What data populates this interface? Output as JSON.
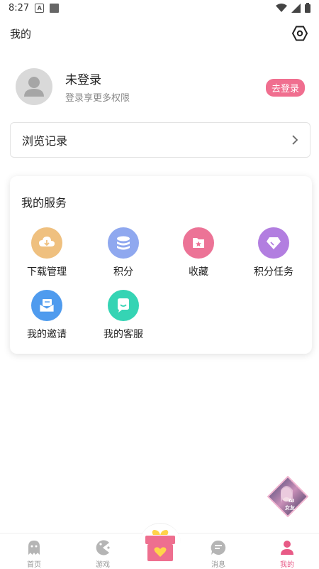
{
  "status_bar": {
    "time": "8:27",
    "notif_letter": "A"
  },
  "header": {
    "title": "我的"
  },
  "profile": {
    "name": "未登录",
    "subtitle": "登录享更多权限",
    "login_button": "去登录"
  },
  "history": {
    "label": "浏览记录"
  },
  "services": {
    "title": "我的服务",
    "items": [
      {
        "label": "下载管理",
        "icon": "download-icon",
        "color": "#efc07f"
      },
      {
        "label": "积分",
        "icon": "points-icon",
        "color": "#8fa8ef"
      },
      {
        "label": "收藏",
        "icon": "favorite-icon",
        "color": "#ec7396"
      },
      {
        "label": "积分任务",
        "icon": "diamond-icon",
        "color": "#b27ee0"
      },
      {
        "label": "我的邀请",
        "icon": "invite-mail-icon",
        "color": "#4f9bee"
      },
      {
        "label": "我的客服",
        "icon": "customer-service-icon",
        "color": "#35d4b4"
      }
    ]
  },
  "floating": {
    "badge_text_1": "AI",
    "badge_text_2": "女友"
  },
  "tabbar": {
    "items": [
      {
        "label": "首页",
        "icon": "ghost-home-icon"
      },
      {
        "label": "游戏",
        "icon": "game-icon"
      },
      {
        "label": "消息",
        "icon": "message-icon"
      },
      {
        "label": "我的",
        "icon": "profile-icon",
        "active": true
      }
    ]
  },
  "colors": {
    "accent": "#f06e8f",
    "active_tab": "#e85a86"
  }
}
